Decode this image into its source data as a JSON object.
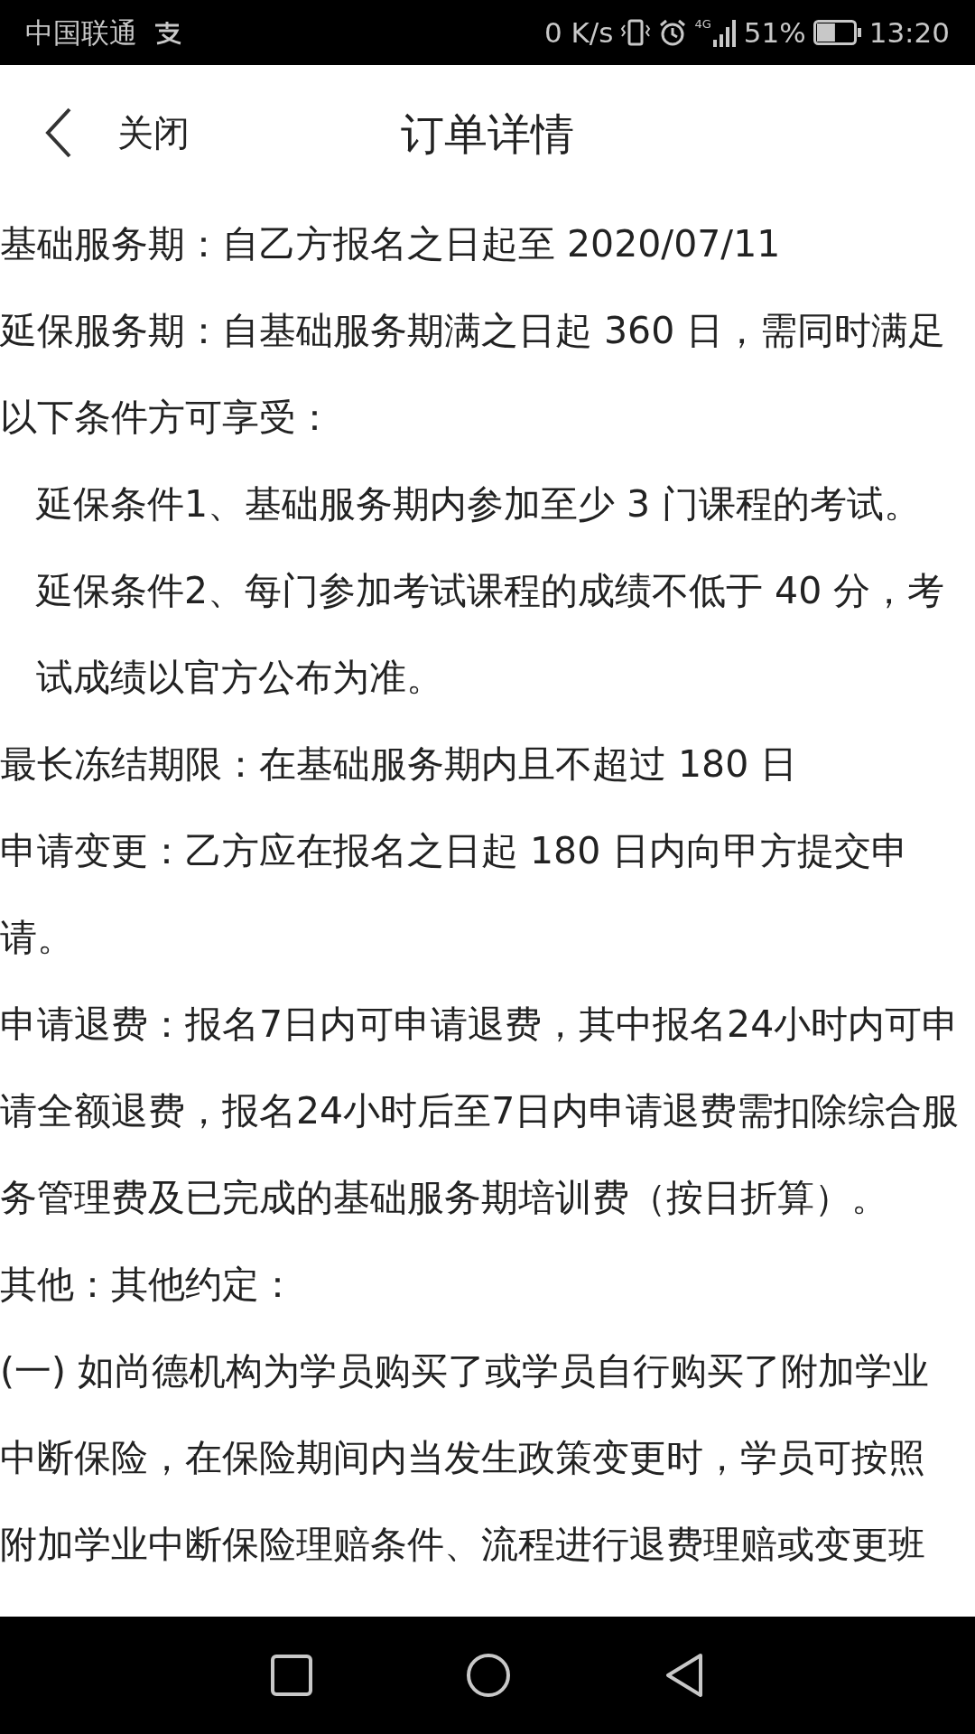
{
  "status_bar": {
    "carrier": "中国联通",
    "network_speed": "0 K/s",
    "network_type": "4G",
    "battery": "51%",
    "time": "13:20"
  },
  "header": {
    "back_label": "关闭",
    "title": "订单详情"
  },
  "paragraphs": [
    {
      "kind": "plain",
      "lines": [
        "基础服务期：自乙方报名之日起至 2020/07/11"
      ]
    },
    {
      "kind": "plain",
      "lines": [
        "延保服务期：自基础服务期满之日起 360 日，需同时满足",
        "以下条件方可享受："
      ]
    },
    {
      "kind": "indent",
      "lines": [
        "延保条件1、基础服务期内参加至少 3 门课程的考试。"
      ]
    },
    {
      "kind": "indent",
      "lines": [
        "延保条件2、每门参加考试课程的成绩不低于 40 分，考",
        "试成绩以官方公布为准。"
      ]
    },
    {
      "kind": "plain",
      "lines": [
        "最长冻结期限：在基础服务期内且不超过 180 日"
      ]
    },
    {
      "kind": "plain",
      "lines": [
        "申请变更：乙方应在报名之日起 180 日内向甲方提交申",
        "请。"
      ]
    },
    {
      "kind": "plain",
      "lines": [
        "申请退费：报名7日内可申请退费，其中报名24小时内可申",
        "请全额退费，报名24小时后至7日内申请退费需扣除综合服",
        "务管理费及已完成的基础服务期培训费（按日折算）。"
      ]
    },
    {
      "kind": "plain",
      "lines": [
        "其他：其他约定："
      ]
    },
    {
      "kind": "plain",
      "lines": [
        "(一) 如尚德机构为学员购买了或学员自行购买了附加学业",
        "中断保险，在保险期间内当发生政策变更时，学员可按照",
        "附加学业中断保险理赔条件、流程进行退费理赔或变更班"
      ]
    }
  ]
}
